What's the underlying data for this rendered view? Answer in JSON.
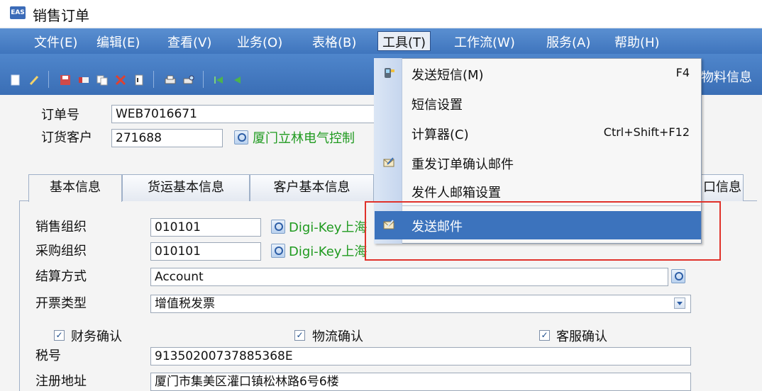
{
  "window": {
    "title": "销售订单",
    "icon": "EAS"
  },
  "menubar": {
    "items": [
      "文件(E)",
      "编辑(E)",
      "查看(V)",
      "业务(O)",
      "表格(B)",
      "工具(T)",
      "工作流(W)",
      "服务(A)",
      "帮助(H)"
    ],
    "active": "工具(T)"
  },
  "toolbar": {
    "right_label": "物料信息"
  },
  "header": {
    "order_no_label": "订单号",
    "order_no": "WEB7016671",
    "customer_label": "订货客户",
    "customer_code": "271688",
    "customer_name": "厦门立林电气控制"
  },
  "tabs": {
    "items": [
      "基本信息",
      "货运基本信息",
      "客户基本信息"
    ],
    "right_tab": "口信息",
    "selected": "基本信息"
  },
  "form": {
    "sales_org_label": "销售组织",
    "sales_org": "010101",
    "sales_org_name": "Digi-Key上海",
    "purchase_org_label": "采购组织",
    "purchase_org": "010101",
    "purchase_org_name": "Digi-Key上海",
    "settlement_label": "结算方式",
    "settlement": "Account",
    "invoice_label": "开票类型",
    "invoice": "增值税发票",
    "finance_confirm": "财务确认",
    "logistics_confirm": "物流确认",
    "service_confirm": "客服确认",
    "tax_label": "税号",
    "tax_no": "91350200737885368E",
    "address_label": "注册地址",
    "address": "厦门市集美区灌口镇松林路6号6楼"
  },
  "tools_menu": {
    "items": [
      {
        "label": "发送短信(M)",
        "shortcut": "F4",
        "icon": "sms-icon"
      },
      {
        "label": "短信设置",
        "shortcut": "",
        "icon": ""
      },
      {
        "label": "计算器(C)",
        "shortcut": "Ctrl+Shift+F12",
        "icon": ""
      },
      {
        "label": "重发订单确认邮件",
        "shortcut": "",
        "icon": "mail-icon"
      },
      {
        "label": "发件人邮箱设置",
        "shortcut": "",
        "icon": ""
      },
      {
        "label": "发送邮件",
        "shortcut": "",
        "icon": "mail-icon"
      }
    ],
    "highlighted": "发送邮件"
  },
  "colors": {
    "menubar": "#4a80c6",
    "highlight": "#3c73bd",
    "annotation": "#e0312a",
    "link_green": "#1f9a1f"
  }
}
